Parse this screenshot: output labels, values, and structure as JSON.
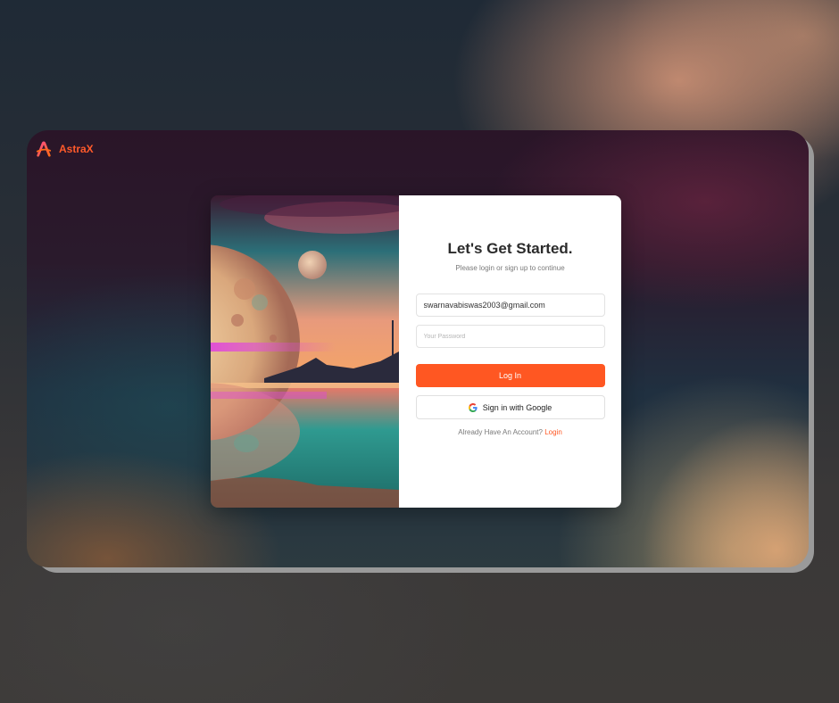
{
  "brand": {
    "name": "AstraX",
    "icon": "astrax-logo-icon"
  },
  "login": {
    "title": "Let's Get Started.",
    "subtitle": "Please login or sign up to continue",
    "email_value": "swarnavabiswas2003@gmail.com",
    "password_placeholder": "Your Password",
    "login_label": "Log In",
    "google_label": "Sign in with Google",
    "footer_text": "Already Have An Account?",
    "footer_link": "Login"
  },
  "colors": {
    "accent": "#ff5722",
    "brand": "#ff5a2a",
    "panel": "#ffffff"
  }
}
